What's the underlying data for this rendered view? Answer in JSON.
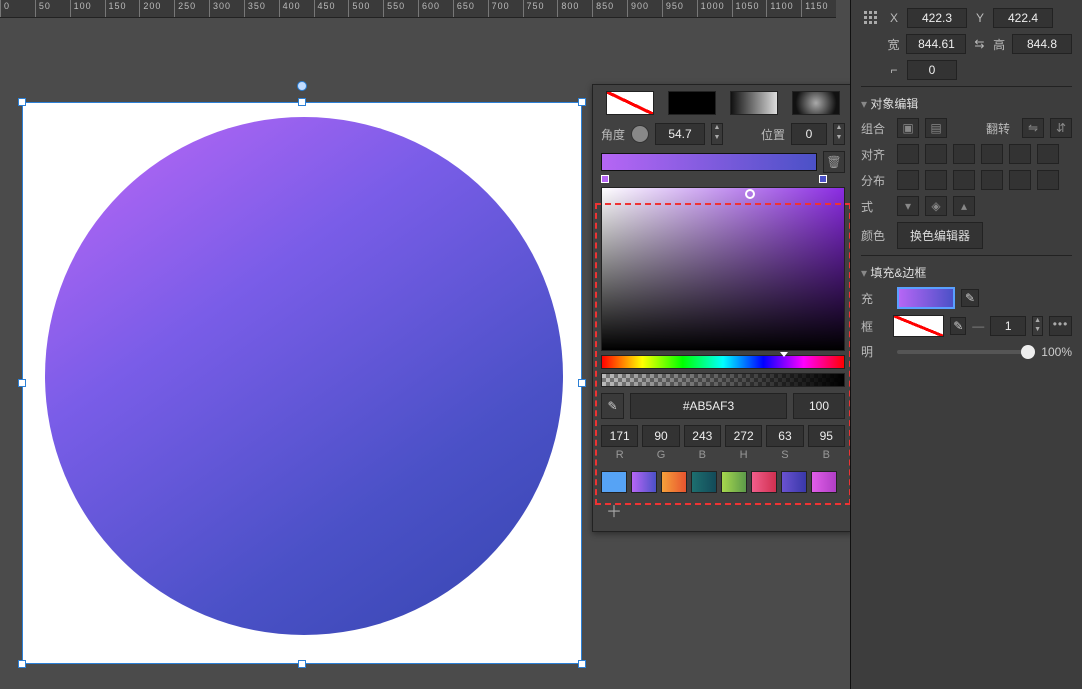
{
  "ruler": {
    "start": 0,
    "end": 1200,
    "step": 50
  },
  "transform": {
    "x_label": "X",
    "x": "422.3",
    "y_label": "Y",
    "y": "422.4",
    "w_label": "宽",
    "w": "844.61",
    "h_label": "高",
    "h": "844.8",
    "angle_label": "⌐",
    "angle": "0"
  },
  "section_object": "对象编辑",
  "labels": {
    "combine": "组合",
    "flip": "翻转",
    "align": "对齐",
    "distribute": "分布",
    "style": "式",
    "color": "颜色",
    "color_editor_button": "换色编辑器"
  },
  "section_fill": "填充&边框",
  "fill_stroke": {
    "fill_label": "充",
    "stroke_label": "框",
    "stroke_width": "1",
    "opacity_label": "明",
    "opacity_value": "100%"
  },
  "popup": {
    "angle_label": "角度",
    "angle_value": "54.7",
    "position_label": "位置",
    "position_value": "0",
    "hex": "#AB5AF3",
    "opacity": "100",
    "R": "171",
    "R_label": "R",
    "G": "90",
    "G_label": "G",
    "B": "243",
    "B_label": "B",
    "H": "272",
    "H_label": "H",
    "S": "63",
    "S_label": "S",
    "B2": "95",
    "B2_label": "B"
  },
  "swatches": [
    "#56a3f5",
    "linear-gradient(90deg,#b666f5,#4b51c7)",
    "linear-gradient(90deg,#f6a13a,#e8542f)",
    "linear-gradient(90deg,#1d6f6f,#134a59)",
    "linear-gradient(90deg,#a7d84d,#5c9a4a)",
    "linear-gradient(90deg,#f05e8b,#d13050)",
    "linear-gradient(90deg,#6a52d0,#3938a9)",
    "linear-gradient(90deg,#e05ee8,#b03ec5)"
  ]
}
